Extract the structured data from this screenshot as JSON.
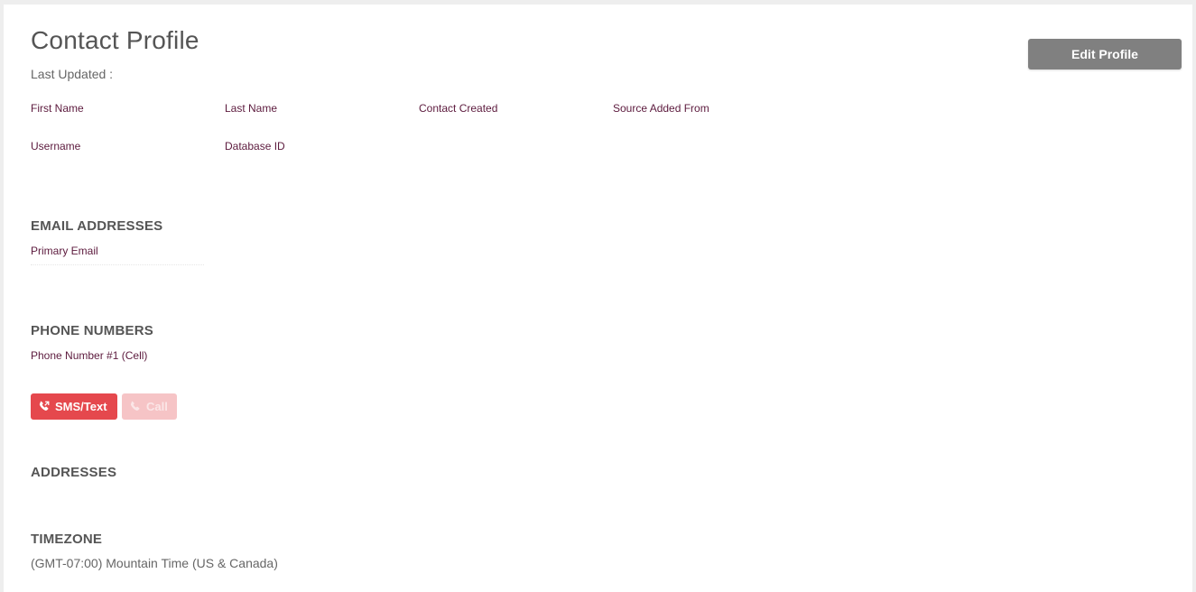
{
  "header": {
    "title": "Contact Profile",
    "last_updated_label": "Last Updated :",
    "edit_button_label": "Edit Profile"
  },
  "profile_fields": {
    "first_name_label": "First Name",
    "last_name_label": "Last Name",
    "contact_created_label": "Contact Created",
    "source_added_from_label": "Source Added From",
    "username_label": "Username",
    "database_id_label": "Database ID"
  },
  "email_section": {
    "title": "EMAIL ADDRESSES",
    "primary_email_label": "Primary Email"
  },
  "phone_section": {
    "title": "PHONE NUMBERS",
    "phone_label": "Phone Number #1 (Cell)",
    "sms_button_label": "SMS/Text",
    "call_button_label": "Call"
  },
  "addresses_section": {
    "title": "ADDRESSES"
  },
  "timezone_section": {
    "title": "TIMEZONE",
    "value": "(GMT-07:00) Mountain Time (US & Canada)"
  },
  "icons": {
    "sms": "phone-forward-icon",
    "call": "phone-icon"
  },
  "colors": {
    "label_color": "#5c1a3d",
    "edit_button_bg": "#808080",
    "sms_button_bg": "#e5484d",
    "call_button_bg": "#f6c4c6"
  }
}
